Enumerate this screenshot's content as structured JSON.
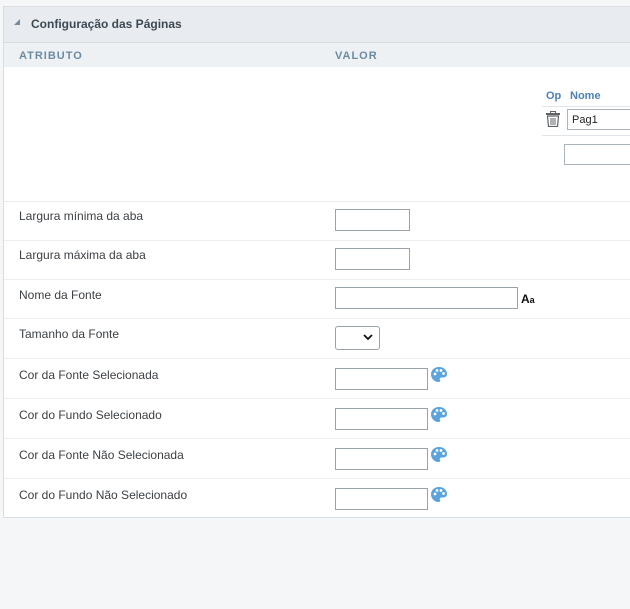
{
  "panel": {
    "title": "Configuração das Páginas"
  },
  "columns": {
    "attribute": "ATRIBUTO",
    "value": "VALOR"
  },
  "pages_grid": {
    "col_op": "Op",
    "col_name": "Nome",
    "rows": [
      {
        "name": "Pag1"
      }
    ],
    "new_name": ""
  },
  "fields": [
    {
      "label": "Largura mínima da aba",
      "value": ""
    },
    {
      "label": "Largura máxima da aba",
      "value": ""
    },
    {
      "label": "Nome da Fonte",
      "value": ""
    },
    {
      "label": "Tamanho da Fonte",
      "value": ""
    },
    {
      "label": "Cor da Fonte Selecionada",
      "value": ""
    },
    {
      "label": "Cor do Fundo Selecionado",
      "value": ""
    },
    {
      "label": "Cor da Fonte Não Selecionada",
      "value": ""
    },
    {
      "label": "Cor do Fundo Não Selecionado",
      "value": ""
    }
  ],
  "icons": {
    "collapse": "collapse-triangle-icon",
    "trash": "trash-icon",
    "font": "font-picker-icon",
    "palette": "color-palette-icon"
  },
  "colors": {
    "accent": "#4a82b8",
    "palette_icon": "#5ba3dc",
    "header_bg": "#e8ecf0"
  }
}
